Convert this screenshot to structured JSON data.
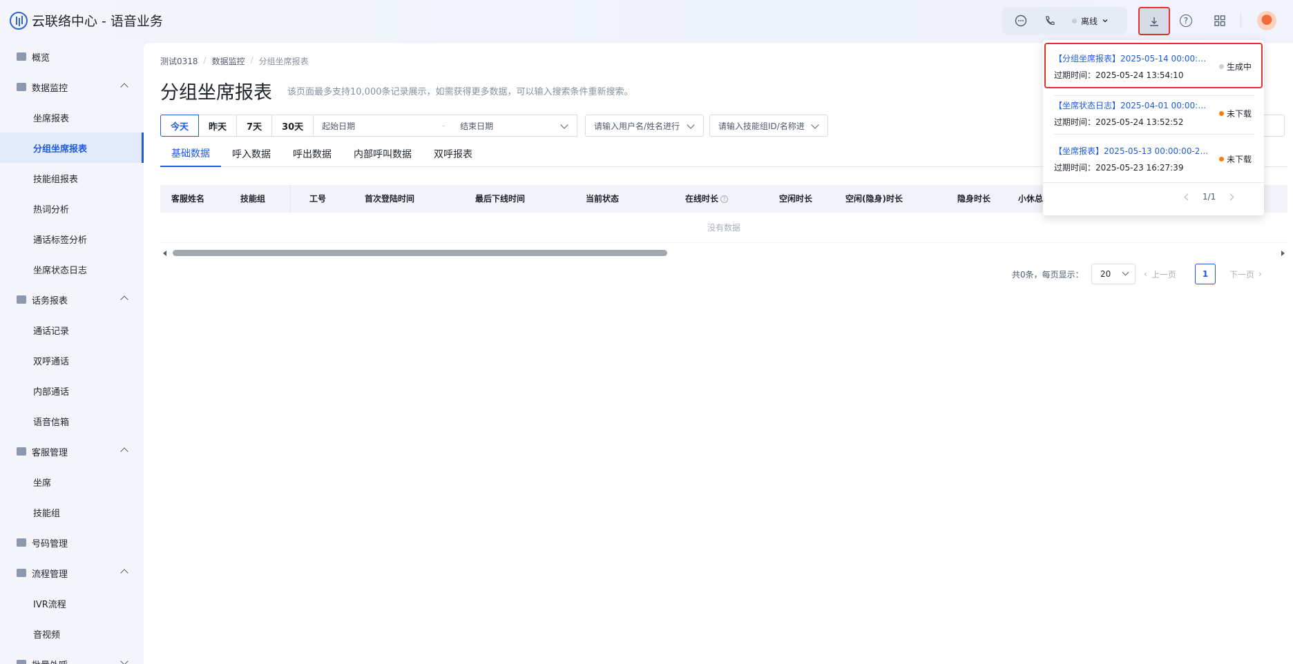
{
  "app": {
    "title": "云联络中心 - 语音业务"
  },
  "header": {
    "status_label": "离线"
  },
  "sidebar": {
    "overview": "概览",
    "data_monitor": "数据监控",
    "agent_report": "坐席报表",
    "group_agent_report": "分组坐席报表",
    "skill_group_report": "技能组报表",
    "hotword_analysis": "热词分析",
    "call_tag_analysis": "通话标签分析",
    "agent_status_log": "坐席状态日志",
    "traffic_report": "话务报表",
    "call_records": "通话记录",
    "dual_call": "双呼通话",
    "internal_call": "内部通话",
    "voicemail": "语音信箱",
    "cs_management": "客服管理",
    "agent": "坐席",
    "skill_group": "技能组",
    "number_management": "号码管理",
    "flow_management": "流程管理",
    "ivr_flow": "IVR流程",
    "audio_video": "音视频",
    "batch_outbound": "批量外呼"
  },
  "breadcrumb": [
    "测试0318",
    "数据监控",
    "分组坐席报表"
  ],
  "page": {
    "title": "分组坐席报表",
    "subtitle": "该页面最多支持10,000条记录展示，如需获得更多数据，可以输入搜索条件重新搜索。"
  },
  "filters": {
    "quick_ranges": [
      "今天",
      "昨天",
      "7天",
      "30天"
    ],
    "start_placeholder": "起始日期",
    "range_sep": "-",
    "end_placeholder": "结束日期",
    "user_placeholder": "请输入用户名/姓名进行",
    "skill_placeholder": "请输入技能组ID/名称进"
  },
  "tabs": [
    "基础数据",
    "呼入数据",
    "呼出数据",
    "内部呼叫数据",
    "双呼报表"
  ],
  "table": {
    "columns": [
      "客服姓名",
      "技能组",
      "工号",
      "首次登陆时间",
      "最后下线时间",
      "当前状态",
      "在线时长",
      "空闲时长",
      "空闲(隐身)时长",
      "隐身时长",
      "小休总时"
    ],
    "qmark": "?",
    "empty_text": "没有数据"
  },
  "pagination": {
    "total_text": "共0条，每页显示：",
    "page_size": "20",
    "prev": "上一页",
    "current": "1",
    "next": "下一页"
  },
  "downloads": {
    "tasks": [
      {
        "name": "【分组坐席报表】2025-05-14 00:00:00...",
        "expire": "过期时间：2025-05-24 13:54:10",
        "status": "生成中",
        "status_color": "#c9cdd4"
      },
      {
        "name": "【坐席状态日志】2025-04-01 00:00:00...",
        "expire": "过期时间：2025-05-24 13:52:52",
        "status": "未下载",
        "status_color": "#ff7d00"
      },
      {
        "name": "【坐席报表】2025-05-13 00:00:00-202...",
        "expire": "过期时间：2025-05-23 16:27:39",
        "status": "未下载",
        "status_color": "#ff7d00"
      }
    ],
    "pager": "1/1"
  },
  "colors": {
    "accent": "#1f5bd6",
    "highlight": "#e0322a"
  }
}
